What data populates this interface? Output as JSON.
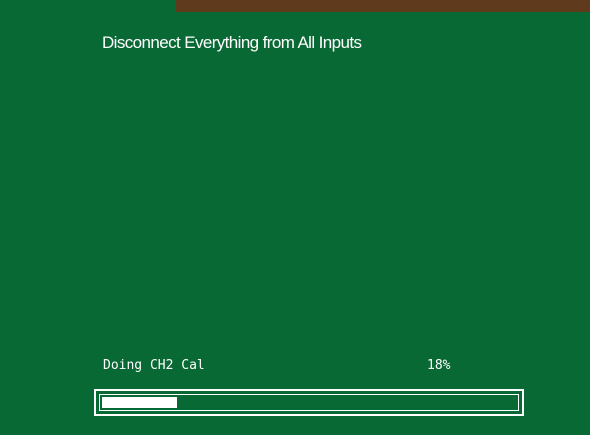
{
  "screen": {
    "instruction": "Disconnect Everything from All Inputs"
  },
  "progress": {
    "status_label": "Doing CH2 Cal",
    "percent_label": "18%",
    "percent_value": 18
  },
  "colors": {
    "background": "#086934",
    "top_strip": "#5f3a1d",
    "text": "#ffffff",
    "progress_fill": "#ffffff"
  }
}
